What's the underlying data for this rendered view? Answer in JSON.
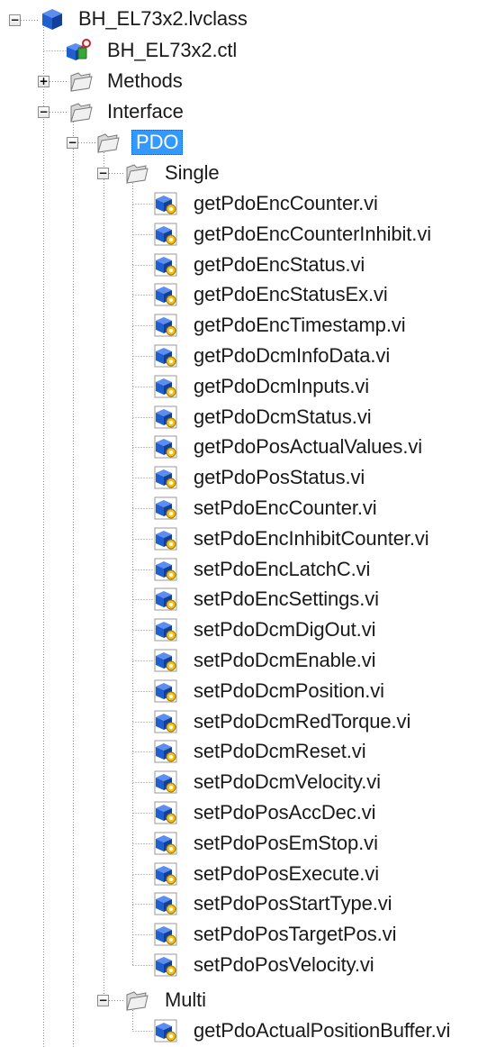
{
  "tree": {
    "root": {
      "label": "BH_EL73x2.lvclass",
      "icon": "lvclass-cube-icon",
      "expanded": true
    },
    "ctl": {
      "label": "BH_EL73x2.ctl",
      "icon": "ctl-control-icon"
    },
    "methods": {
      "label": "Methods",
      "icon": "folder-icon",
      "expanded": false
    },
    "interface": {
      "label": "Interface",
      "icon": "folder-icon",
      "expanded": true
    },
    "pdo": {
      "label": "PDO",
      "icon": "folder-icon",
      "expanded": true,
      "selected": true
    },
    "single": {
      "label": "Single",
      "icon": "folder-icon",
      "expanded": true,
      "items": [
        "getPdoEncCounter.vi",
        "getPdoEncCounterInhibit.vi",
        "getPdoEncStatus.vi",
        "getPdoEncStatusEx.vi",
        "getPdoEncTimestamp.vi",
        "getPdoDcmInfoData.vi",
        "getPdoDcmInputs.vi",
        "getPdoDcmStatus.vi",
        "getPdoPosActualValues.vi",
        "getPdoPosStatus.vi",
        "setPdoEncCounter.vi",
        "setPdoEncInhibitCounter.vi",
        "setPdoEncLatchC.vi",
        "setPdoEncSettings.vi",
        "setPdoDcmDigOut.vi",
        "setPdoDcmEnable.vi",
        "setPdoDcmPosition.vi",
        "setPdoDcmRedTorque.vi",
        "setPdoDcmReset.vi",
        "setPdoDcmVelocity.vi",
        "setPdoPosAccDec.vi",
        "setPdoPosEmStop.vi",
        "setPdoPosExecute.vi",
        "setPdoPosStartType.vi",
        "setPdoPosTargetPos.vi",
        "setPdoPosVelocity.vi"
      ]
    },
    "multi": {
      "label": "Multi",
      "icon": "folder-icon",
      "expanded": true,
      "items": [
        "getPdoActualPositionBuffer.vi"
      ]
    },
    "vi_icon": "vi-method-icon",
    "colors": {
      "selection": "#3399ff",
      "lines": "#8c8c8c",
      "cube": "#1f5fd0"
    }
  }
}
